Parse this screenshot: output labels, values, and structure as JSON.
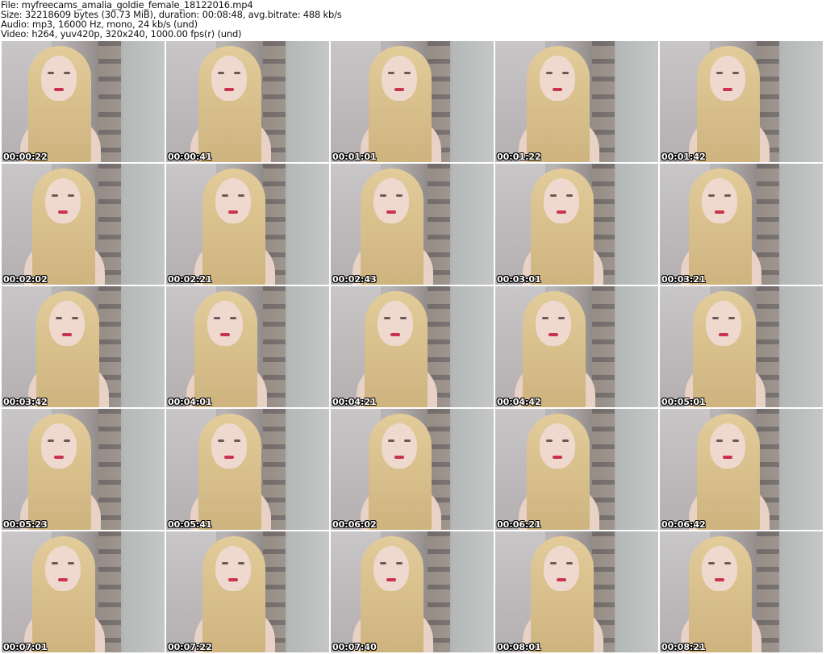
{
  "info": {
    "file": "File: myfreecams_amalia_goldie_female_18122016.mp4",
    "size": "Size: 32218609 bytes (30.73 MiB), duration: 00:08:48, avg.bitrate: 488 kb/s",
    "audio": "Audio: mp3, 16000 Hz, mono, 24 kb/s (und)",
    "video": "Video: h264, yuv420p, 320x240, 1000.00 fps(r) (und)"
  },
  "thumbnails": [
    "00:00:22",
    "00:00:41",
    "00:01:01",
    "00:01:22",
    "00:01:42",
    "00:02:02",
    "00:02:21",
    "00:02:43",
    "00:03:01",
    "00:03:21",
    "00:03:42",
    "00:04:01",
    "00:04:21",
    "00:04:42",
    "00:05:01",
    "00:05:23",
    "00:05:41",
    "00:06:02",
    "00:06:21",
    "00:06:42",
    "00:07:01",
    "00:07:22",
    "00:07:40",
    "00:08:01",
    "00:08:21"
  ]
}
